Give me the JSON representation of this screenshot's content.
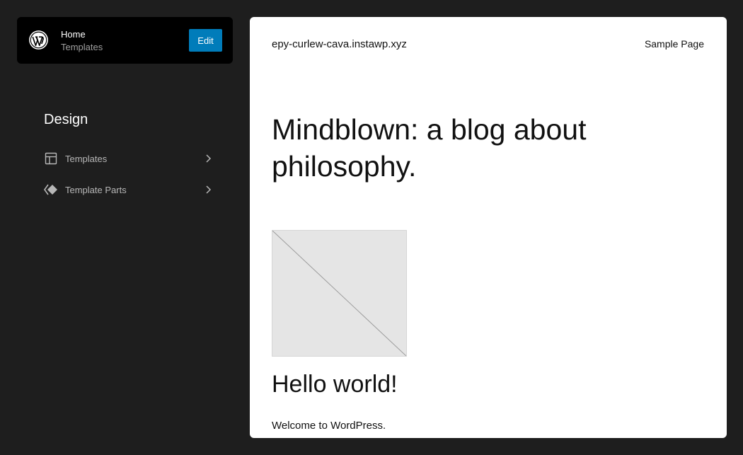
{
  "header": {
    "title": "Home",
    "subtitle": "Templates",
    "edit_label": "Edit",
    "logo_icon": "wordpress-icon"
  },
  "sidebar": {
    "title": "Design",
    "items": [
      {
        "label": "Templates",
        "icon": "layout-icon"
      },
      {
        "label": "Template Parts",
        "icon": "symbol-icon"
      }
    ]
  },
  "preview": {
    "site_title": "epy-curlew-cava.instawp.xyz",
    "nav_link": "Sample Page",
    "tagline": "Mindblown: a blog about philosophy.",
    "post_title": "Hello world!",
    "post_excerpt": "Welcome to WordPress."
  },
  "colors": {
    "background": "#1e1e1e",
    "accent": "#007cba",
    "header_bg": "#000000"
  }
}
